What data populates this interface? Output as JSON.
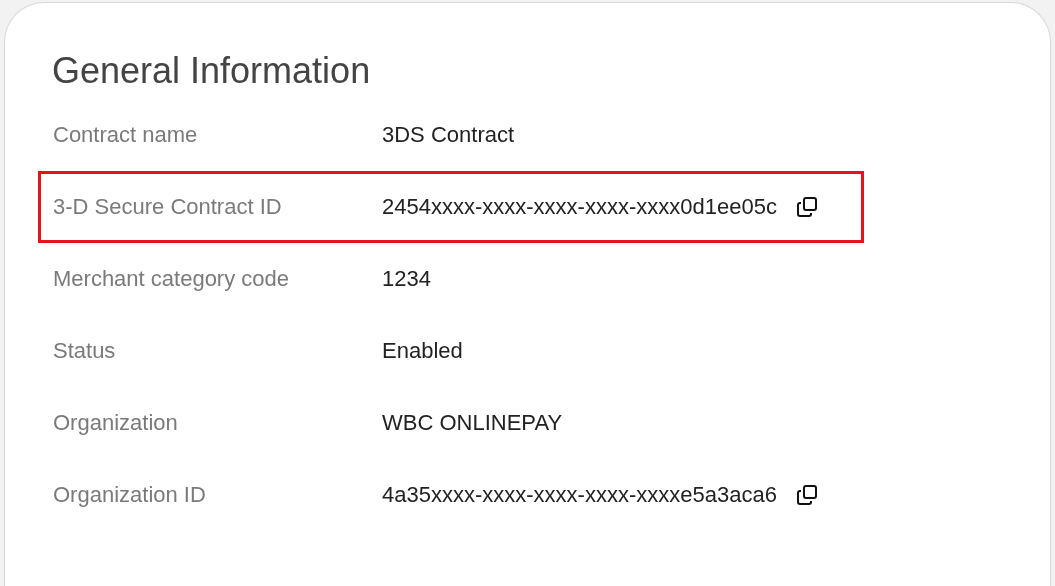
{
  "card": {
    "title": "General Information"
  },
  "rows": [
    {
      "label": "Contract name",
      "value": "3DS Contract",
      "copyable": false,
      "highlighted": false
    },
    {
      "label": "3-D Secure Contract ID",
      "value": "2454xxxx-xxxx-xxxx-xxxx-xxxx0d1ee05c",
      "copyable": true,
      "highlighted": true
    },
    {
      "label": "Merchant category code",
      "value": "1234",
      "copyable": false,
      "highlighted": false
    },
    {
      "label": "Status",
      "value": "Enabled",
      "copyable": false,
      "highlighted": false
    },
    {
      "label": "Organization",
      "value": "WBC ONLINEPAY",
      "copyable": false,
      "highlighted": false
    },
    {
      "label": "Organization ID",
      "value": "4a35xxxx-xxxx-xxxx-xxxx-xxxxe5a3aca6",
      "copyable": true,
      "highlighted": false
    }
  ]
}
